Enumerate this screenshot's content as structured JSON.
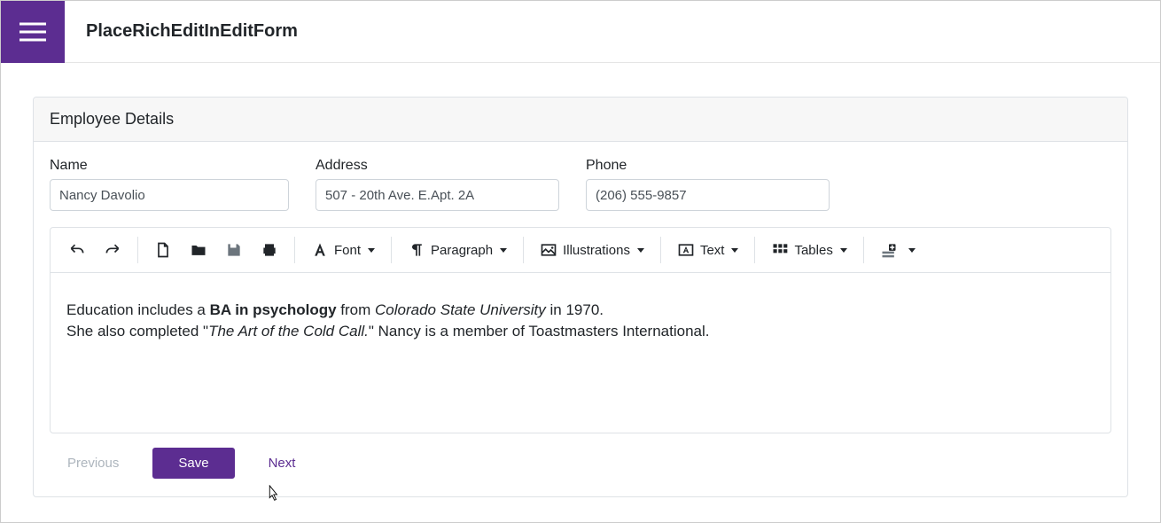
{
  "app": {
    "title": "PlaceRichEditInEditForm"
  },
  "card": {
    "title": "Employee Details"
  },
  "fields": {
    "name": {
      "label": "Name",
      "value": "Nancy Davolio"
    },
    "address": {
      "label": "Address",
      "value": "507 - 20th Ave. E.Apt. 2A"
    },
    "phone": {
      "label": "Phone",
      "value": "(206) 555-9857"
    }
  },
  "toolbar": {
    "font": "Font",
    "paragraph": "Paragraph",
    "illustrations": "Illustrations",
    "text": "Text",
    "tables": "Tables"
  },
  "editor": {
    "line1_prefix": "Education includes a ",
    "line1_bold": "BA in psychology",
    "line1_mid": " from ",
    "line1_italic": "Colorado State University",
    "line1_suffix": " in 1970.",
    "line2_prefix": "She also completed \"",
    "line2_italic": "The Art of the Cold Call.",
    "line2_suffix": "\"  Nancy is a member of Toastmasters International."
  },
  "footer": {
    "previous": "Previous",
    "save": "Save",
    "next": "Next"
  }
}
